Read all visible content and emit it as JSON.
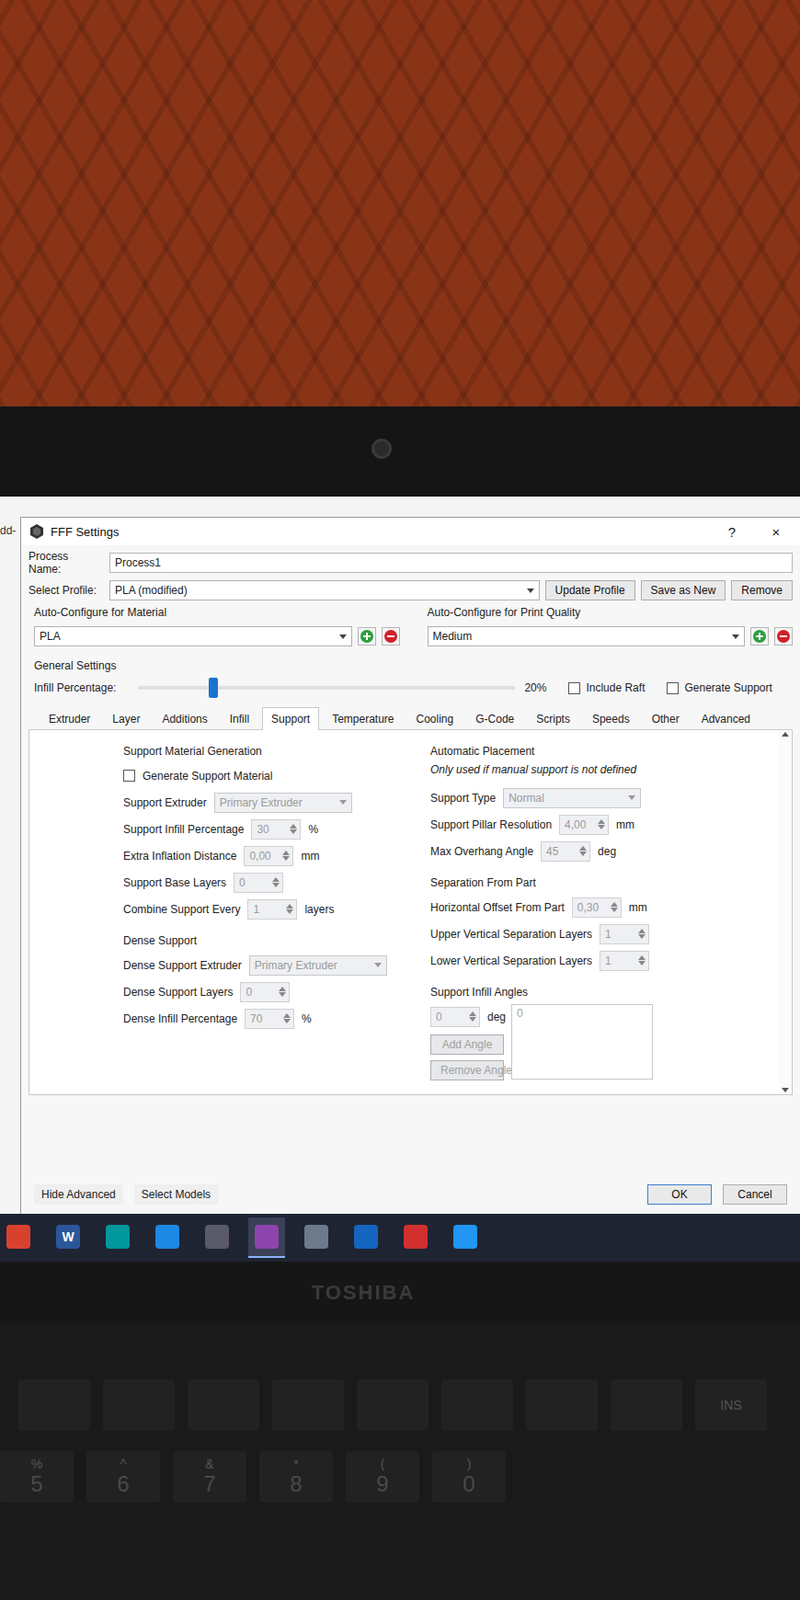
{
  "background_window": {
    "text": "dd-"
  },
  "window": {
    "title": "FFF Settings",
    "help": "?",
    "close": "×"
  },
  "process": {
    "label": "Process Name:",
    "value": "Process1"
  },
  "profile": {
    "label": "Select Profile:",
    "value": "PLA (modified)",
    "buttons": [
      "Update Profile",
      "Save as New",
      "Remove"
    ]
  },
  "auto_configure": [
    {
      "label": "Auto-Configure for Material",
      "value": "PLA"
    },
    {
      "label": "Auto-Configure for Print Quality",
      "value": "Medium"
    }
  ],
  "general": {
    "title": "General Settings",
    "infill_label": "Infill Percentage:",
    "infill_level": 0.2,
    "infill_reading": "20%",
    "checkboxes": [
      {
        "label": "Include Raft",
        "checked": false
      },
      {
        "label": "Generate Support",
        "checked": false
      }
    ]
  },
  "tabs": [
    {
      "label": "Extruder",
      "selected": false
    },
    {
      "label": "Layer",
      "selected": false
    },
    {
      "label": "Additions",
      "selected": false
    },
    {
      "label": "Infill",
      "selected": false
    },
    {
      "label": "Support",
      "selected": true
    },
    {
      "label": "Temperature",
      "selected": false
    },
    {
      "label": "Cooling",
      "selected": false
    },
    {
      "label": "G-Code",
      "selected": false
    },
    {
      "label": "Scripts",
      "selected": false
    },
    {
      "label": "Speeds",
      "selected": false
    },
    {
      "label": "Other",
      "selected": false
    },
    {
      "label": "Advanced",
      "selected": false
    }
  ],
  "left_groups": [
    {
      "title": "Support Material Generation",
      "rows": [
        {
          "kind": "checkbox",
          "label": "Generate Support Material",
          "checked": false,
          "disabled": false
        },
        {
          "kind": "select",
          "label": "Support Extruder",
          "value": "Primary Extruder",
          "unit": "",
          "disabled": true
        },
        {
          "kind": "spin",
          "label": "Support Infill Percentage",
          "value": "30",
          "unit": "%",
          "disabled": true
        },
        {
          "kind": "spin",
          "label": "Extra Inflation Distance",
          "value": "0,00",
          "unit": "mm",
          "disabled": true
        },
        {
          "kind": "spin",
          "label": "Support Base Layers",
          "value": "0",
          "unit": "",
          "disabled": true
        },
        {
          "kind": "spin",
          "label": "Combine Support Every",
          "value": "1",
          "unit": "layers",
          "disabled": true
        }
      ]
    },
    {
      "title": "Dense Support",
      "rows": [
        {
          "kind": "select",
          "label": "Dense Support Extruder",
          "value": "Primary Extruder",
          "unit": "",
          "disabled": true
        },
        {
          "kind": "spin",
          "label": "Dense Support Layers",
          "value": "0",
          "unit": "",
          "disabled": true
        },
        {
          "kind": "spin",
          "label": "Dense Infill Percentage",
          "value": "70",
          "unit": "%",
          "disabled": true
        }
      ]
    }
  ],
  "right_groups": [
    {
      "title": "Automatic Placement",
      "note": "Only used if manual support is not defined",
      "rows": [
        {
          "kind": "select",
          "label": "Support Type",
          "value": "Normal",
          "unit": "",
          "disabled": true
        },
        {
          "kind": "spin",
          "label": "Support Pillar Resolution",
          "value": "4,00",
          "unit": "mm",
          "disabled": true
        },
        {
          "kind": "spin",
          "label": "Max Overhang Angle",
          "value": "45",
          "unit": "deg",
          "disabled": true
        }
      ]
    },
    {
      "title": "Separation From Part",
      "note": "",
      "rows": [
        {
          "kind": "spin",
          "label": "Horizontal Offset From Part",
          "value": "0,30",
          "unit": "mm",
          "disabled": true
        },
        {
          "kind": "spin",
          "label": "Upper Vertical Separation Layers",
          "value": "1",
          "unit": "",
          "disabled": true
        },
        {
          "kind": "spin",
          "label": "Lower Vertical Separation Layers",
          "value": "1",
          "unit": "",
          "disabled": true
        }
      ]
    }
  ],
  "angles": {
    "title": "Support Infill Angles",
    "value": "0",
    "unit": "deg",
    "list": [
      "0"
    ],
    "buttons": [
      "Add Angle",
      "Remove Angle"
    ],
    "disabled": true
  },
  "footer": {
    "left_buttons": [
      "Hide Advanced",
      "Select Models"
    ],
    "ok": "OK",
    "cancel": "Cancel"
  },
  "taskbar": [
    {
      "label": "",
      "color": "#d9412f",
      "selected": false
    },
    {
      "label": "W",
      "color": "#2b579a",
      "selected": false
    },
    {
      "label": "",
      "color": "#00979d",
      "selected": false
    },
    {
      "label": "",
      "color": "#1e88e5",
      "selected": false
    },
    {
      "label": "",
      "color": "#5a5a6a",
      "selected": false
    },
    {
      "label": "",
      "color": "#8e44ad",
      "selected": true
    },
    {
      "label": "",
      "color": "#6b7b8c",
      "selected": false
    },
    {
      "label": "",
      "color": "#1565c0",
      "selected": false
    },
    {
      "label": "",
      "color": "#d32f2f",
      "selected": false
    },
    {
      "label": "",
      "color": "#2196f3",
      "selected": false
    }
  ],
  "bezel": {
    "logo": "TOSHIBA"
  },
  "keyboard": {
    "function_keys": [
      "INS"
    ],
    "number_keys": [
      {
        "main": "5",
        "shift": "%"
      },
      {
        "main": "6",
        "shift": "^"
      },
      {
        "main": "7",
        "shift": "&"
      },
      {
        "main": "8",
        "shift": "*"
      },
      {
        "main": "9",
        "shift": "("
      },
      {
        "main": "0",
        "shift": ")"
      }
    ]
  }
}
